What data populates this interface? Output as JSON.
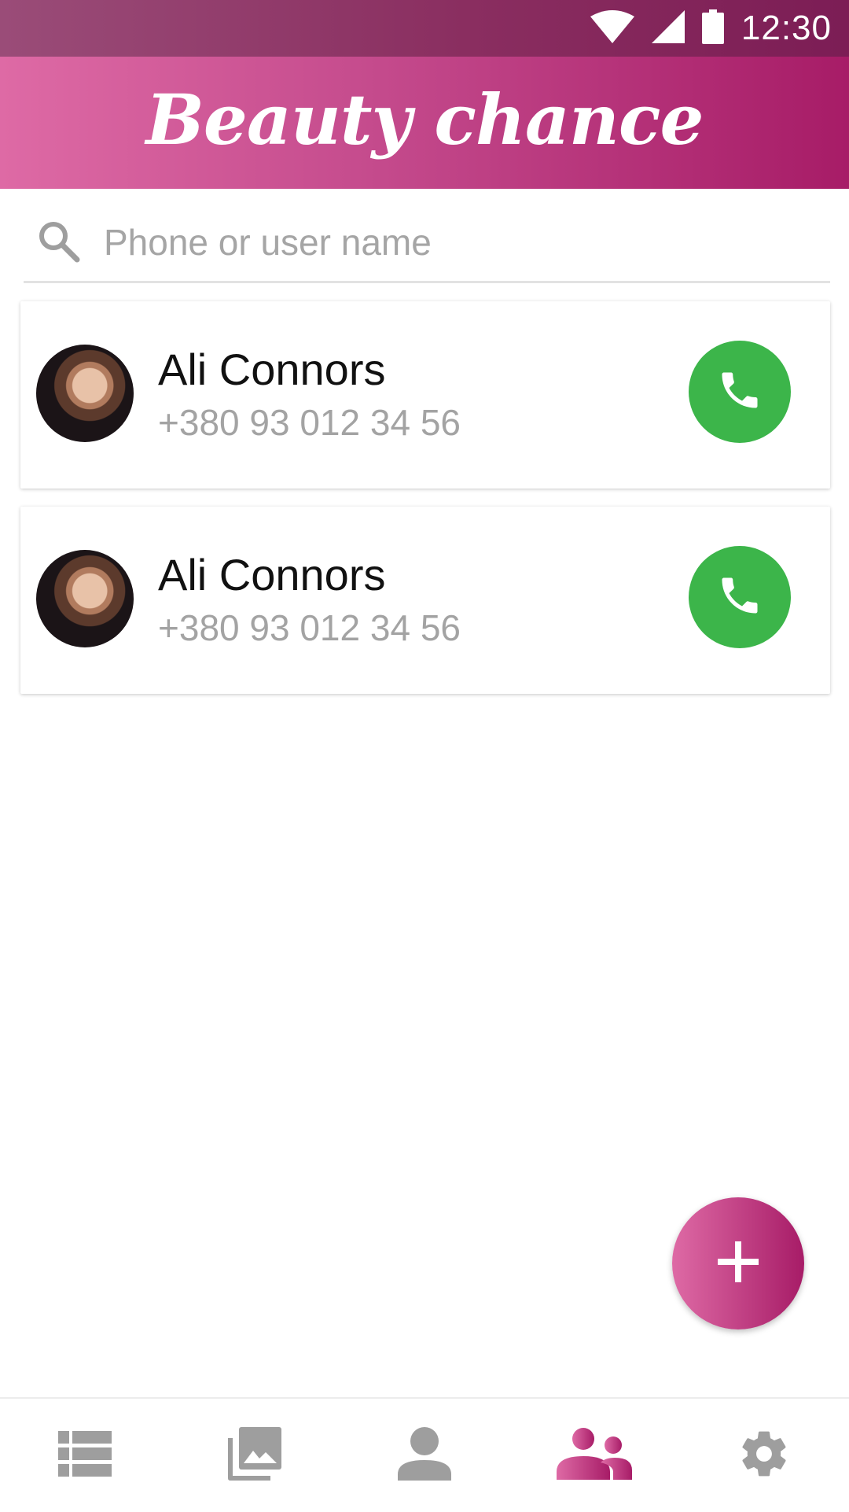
{
  "status_bar": {
    "time": "12:30",
    "icons": [
      "wifi-icon",
      "cell-signal-icon",
      "battery-icon"
    ]
  },
  "app_bar": {
    "title": "Beauty chance"
  },
  "search": {
    "placeholder": "Phone or user name",
    "value": ""
  },
  "contacts": [
    {
      "name": "Ali Connors",
      "phone": "+380 93 012 34 56"
    },
    {
      "name": "Ali Connors",
      "phone": "+380 93 012 34 56"
    }
  ],
  "fab": {
    "icon": "plus-icon"
  },
  "bottom_nav": {
    "items": [
      {
        "icon": "list-icon",
        "active": false
      },
      {
        "icon": "gallery-icon",
        "active": false
      },
      {
        "icon": "person-icon",
        "active": false
      },
      {
        "icon": "group-icon",
        "active": true
      },
      {
        "icon": "settings-icon",
        "active": false
      }
    ]
  },
  "colors": {
    "brand_start": "#de6aa5",
    "brand_end": "#a71c67",
    "call_green": "#3cb54a",
    "icon_inactive": "#9e9e9e",
    "text_secondary": "#a3a3a3"
  }
}
